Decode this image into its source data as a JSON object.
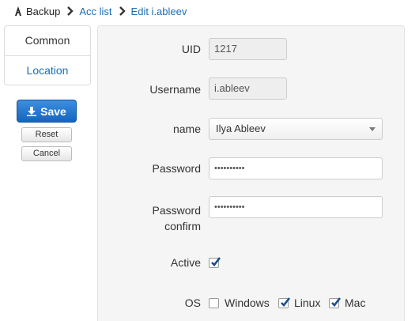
{
  "breadcrumb": {
    "home_label": "Backup",
    "link_1": "Acc list",
    "link_2": "Edit i.ableev"
  },
  "sidebar": {
    "items": [
      {
        "label": "Common"
      },
      {
        "label": "Location"
      }
    ]
  },
  "actions": {
    "save_label": "Save",
    "reset_label": "Reset",
    "cancel_label": "Cancel"
  },
  "form": {
    "uid_label": "UID",
    "uid_value": "1217",
    "username_label": "Username",
    "username_value": "i.ableev",
    "name_label": "name",
    "name_value": "Ilya Ableev",
    "password_label": "Password",
    "password_value": "••••••••••",
    "confirm_label_1": "Password",
    "confirm_label_2": "confirm",
    "confirm_value": "••••••••••",
    "active_label": "Active",
    "active_checked": true,
    "os_label": "OS",
    "os_options": [
      {
        "label": "Windows",
        "checked": false
      },
      {
        "label": "Linux",
        "checked": true
      },
      {
        "label": "Mac",
        "checked": true
      }
    ]
  },
  "colors": {
    "link": "#1a6eb8",
    "primary_button": "#1565c0",
    "checkmark": "#1a4f8b"
  }
}
